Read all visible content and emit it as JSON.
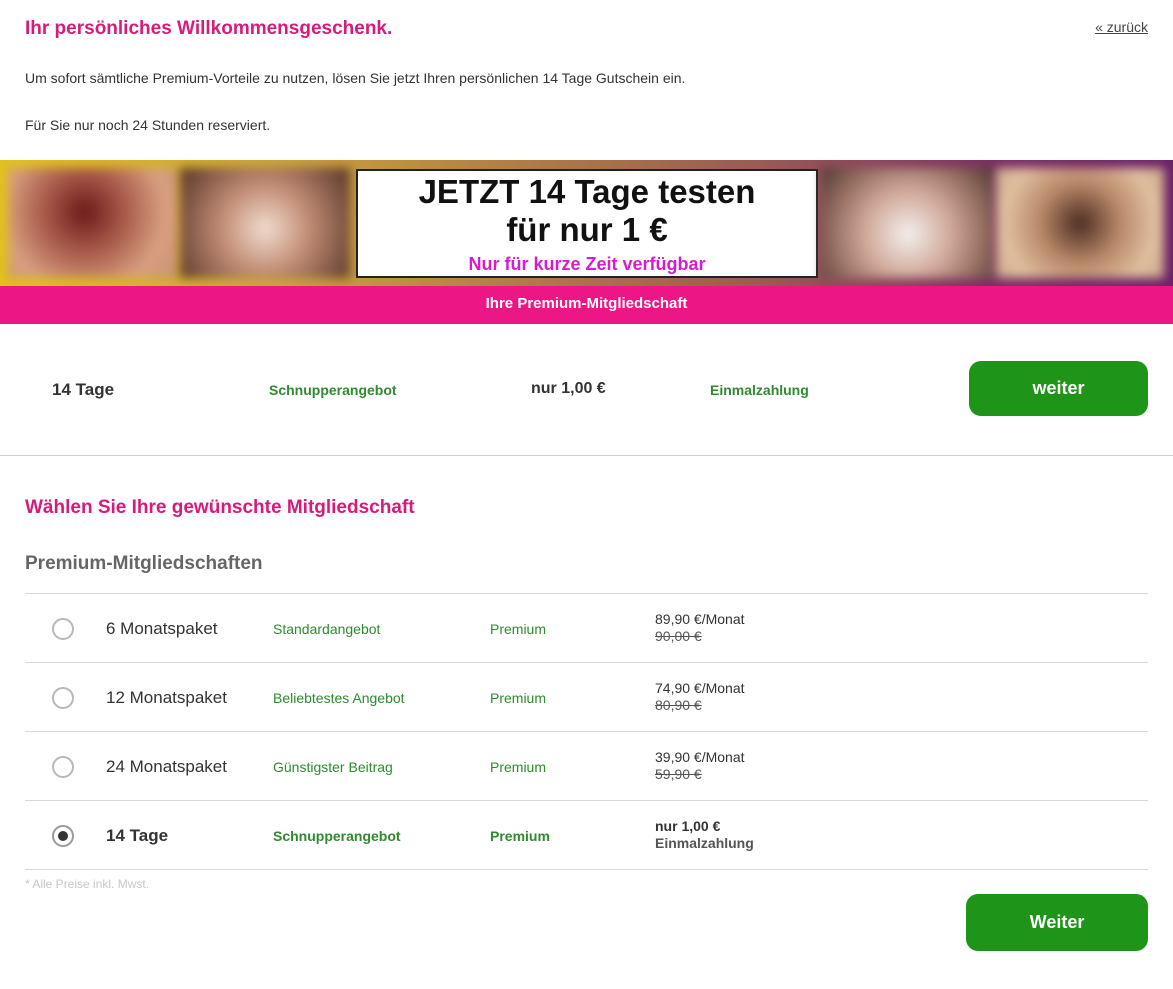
{
  "header": {
    "title": "Ihr persönliches Willkommensgeschenk.",
    "back_link": "« zurück",
    "intro": "Um sofort sämtliche Premium-Vorteile zu nutzen, lösen Sie jetzt Ihren persönlichen 14 Tage Gutschein ein.",
    "reserved": "Für Sie nur noch 24 Stunden reserviert."
  },
  "banner": {
    "line1": "JETZT 14 Tage testen",
    "line2": "für nur 1 €",
    "line3": "Nur für kurze Zeit verfügbar"
  },
  "premium_bar": {
    "label": "Ihre Premium-Mitgliedschaft"
  },
  "offer": {
    "duration": "14 Tage",
    "type": "Schnupperangebot",
    "price": "nur 1,00 €",
    "payment": "Einmalzahlung",
    "button": "weiter"
  },
  "choose": {
    "title": "Wählen Sie Ihre gewünschte Mitgliedschaft",
    "section": "Premium-Mitgliedschaften"
  },
  "plans": [
    {
      "name": "6 Monatspaket",
      "offer": "Standardangebot",
      "tier": "Premium",
      "price": "89,90 €/Monat",
      "old_price": "90,00 €",
      "selected": false
    },
    {
      "name": "12 Monatspaket",
      "offer": "Beliebtestes Angebot",
      "tier": "Premium",
      "price": "74,90 €/Monat",
      "old_price": "80,90 €",
      "selected": false
    },
    {
      "name": "24 Monatspaket",
      "offer": "Günstigster Beitrag",
      "tier": "Premium",
      "price": "39,90 €/Monat",
      "old_price": "59,90 €",
      "selected": false
    },
    {
      "name": "14 Tage",
      "offer": "Schnupperangebot",
      "tier": "Premium",
      "price": "nur 1,00 €",
      "sub_price": "Einmalzahlung",
      "selected": true
    }
  ],
  "footnote": "* Alle Preise inkl. Mwst.",
  "submit_button": "Weiter",
  "colors": {
    "accent_pink": "#d81b7a",
    "bar_pink": "#ec1685",
    "button_green": "#1e9418",
    "text_green": "#2e8b2e"
  }
}
